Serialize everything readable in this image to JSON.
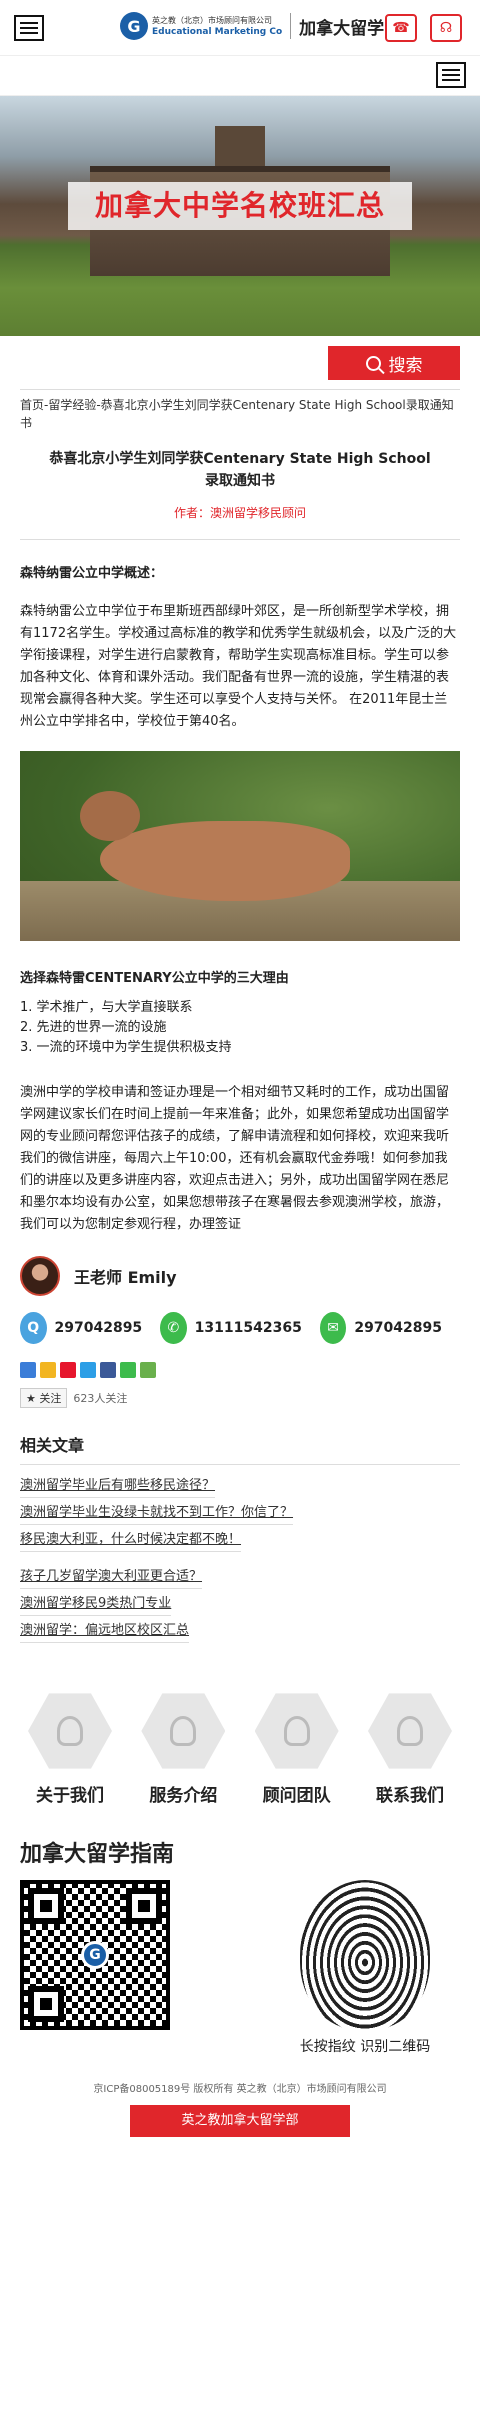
{
  "header": {
    "brand_line1": "英之教（北京）市场顾问有限公司",
    "brand_line2": "Educational Marketing Co",
    "brand_title": "加拿大留学",
    "logo_letter": "G",
    "phone_icon": "phone-icon",
    "headset_icon": "headset-icon"
  },
  "banner": {
    "title": "加拿大中学名校班汇总"
  },
  "search": {
    "placeholder": "",
    "button_label": "搜索"
  },
  "breadcrumb": "首页-留学经验-恭喜北京小学生刘同学获Centenary State High School录取通知书",
  "article": {
    "title": "恭喜北京小学生刘同学获Centenary State High School录取通知书",
    "author": "作者：澳洲留学移民顾问",
    "overview_heading": "森特纳雷公立中学概述：",
    "overview_text": "森特纳雷公立中学位于布里斯班西部绿叶郊区，是一所创新型学术学校，拥有1172名学生。学校通过高标准的教学和优秀学生就级机会，以及广泛的大学衔接课程，对学生进行启蒙教育，帮助学生实现高标准目标。学生可以参加各种文化、体育和课外活动。我们配备有世界一流的设施，学生精湛的表现常会赢得各种大奖。学生还可以享受个人支持与关怀。 在2011年昆士兰州公立中学排名中，学校位于第40名。",
    "reasons_heading": "选择森特雷CENTENARY公立中学的三大理由",
    "reasons": [
      "1. 学术推广，与大学直接联系",
      "2. 先进的世界一流的设施",
      "3. 一流的环境中为学生提供积极支持"
    ],
    "closing_text": "澳洲中学的学校申请和签证办理是一个相对细节又耗时的工作，成功出国留学网建议家长们在时间上提前一年来准备；此外，如果您希望成功出国留学网的专业顾问帮您评估孩子的成绩，了解申请流程和如何择校，欢迎来我听我们的微信讲座，每周六上午10:00，还有机会赢取代金券哦！如何参加我们的讲座以及更多讲座内容，欢迎点击进入；另外，成功出国留学网在悉尼和墨尔本均设有办公室，如果您想带孩子在寒暑假去参观澳洲学校，旅游，我们可以为您制定参观行程，办理签证"
  },
  "teacher": {
    "name": "王老师 Emily"
  },
  "contacts": [
    {
      "icon": "qq-icon",
      "value": "297042895",
      "color": "#4aa3df"
    },
    {
      "icon": "whatsapp-icon",
      "value": "13111542365",
      "color": "#3dbb4c"
    },
    {
      "icon": "wechat-icon",
      "value": "297042895",
      "color": "#3dbb4c"
    }
  ],
  "follow": {
    "label": "关注",
    "count": "623人关注"
  },
  "related": {
    "heading": "相关文章",
    "items": [
      "澳洲留学毕业后有哪些移民途径？",
      "澳洲留学毕业生没绿卡就找不到工作？你信了？",
      "移民澳大利亚，什么时候决定都不晚！",
      "孩子几岁留学澳大利亚更合适？",
      "澳洲留学移民9类热门专业",
      "澳洲留学：偏远地区校区汇总"
    ]
  },
  "nav": [
    {
      "label": "关于我们",
      "icon": "people-icon"
    },
    {
      "label": "服务介绍",
      "icon": "meeting-icon"
    },
    {
      "label": "顾问团队",
      "icon": "team-icon"
    },
    {
      "label": "联系我们",
      "icon": "telephone-icon"
    }
  ],
  "guide": {
    "heading": "加拿大留学指南",
    "caption": "长按指纹 识别二维码"
  },
  "footer": {
    "icp": "京ICP备08005189号 版权所有 英之教（北京）市场顾问有限公司",
    "bar": "英之教加拿大留学部"
  },
  "colors": {
    "accent": "#e0262b",
    "brand_blue": "#1b5fa7"
  }
}
